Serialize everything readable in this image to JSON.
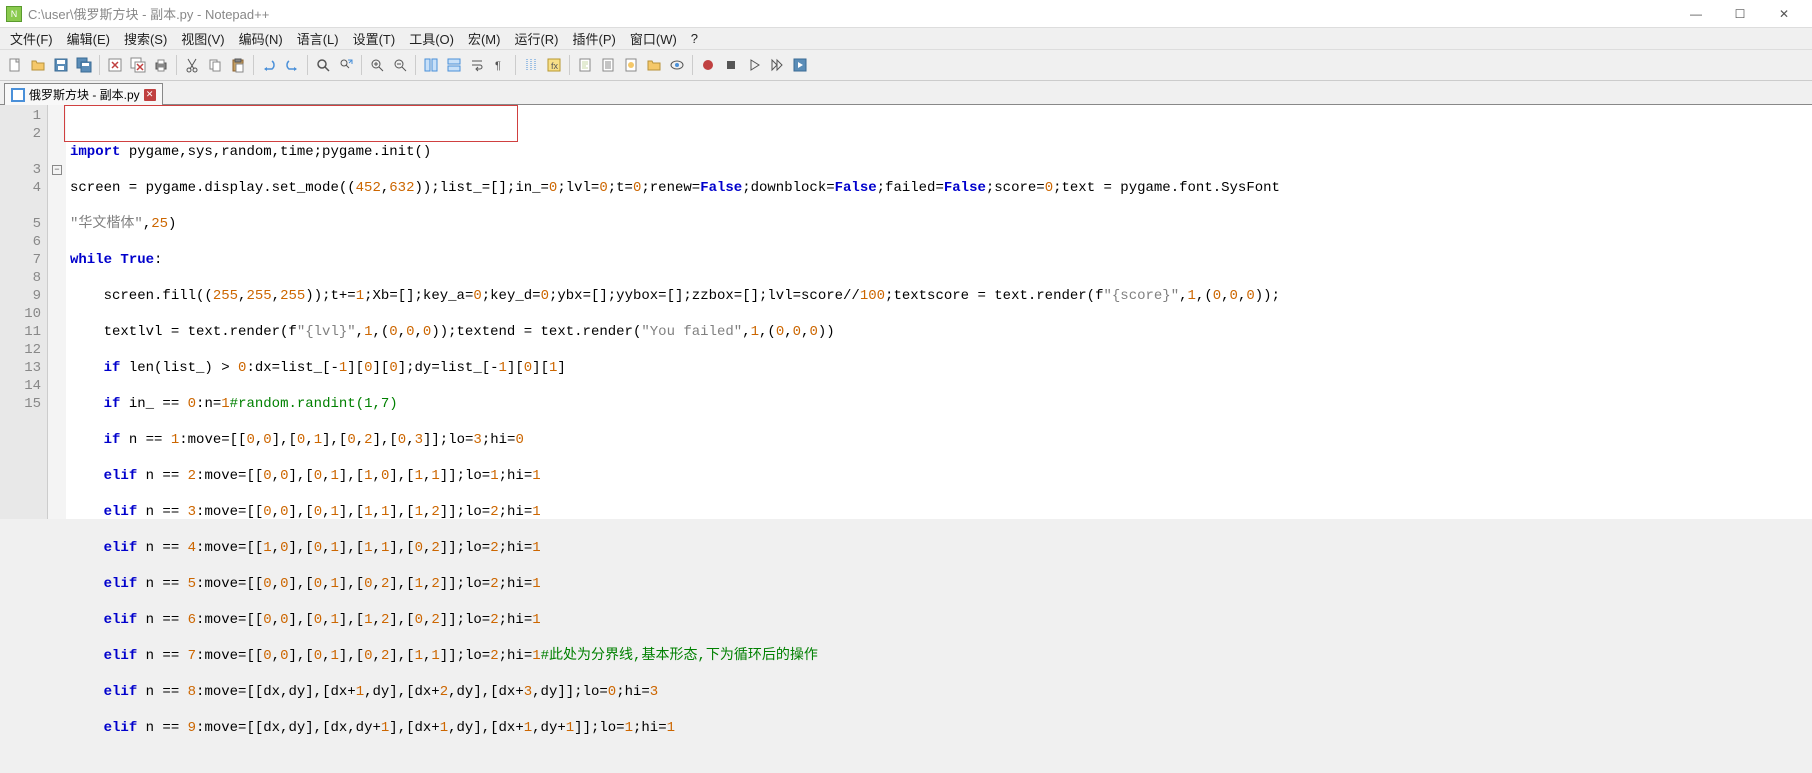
{
  "window": {
    "title": "C:\\user\\俄罗斯方块 - 副本.py - Notepad++"
  },
  "menu": {
    "items": [
      "文件(F)",
      "编辑(E)",
      "搜索(S)",
      "视图(V)",
      "编码(N)",
      "语言(L)",
      "设置(T)",
      "工具(O)",
      "宏(M)",
      "运行(R)",
      "插件(P)",
      "窗口(W)",
      "?"
    ]
  },
  "tab": {
    "label": "俄罗斯方块 - 副本.py"
  },
  "gutter": {
    "lines": [
      "1",
      "2",
      "",
      "3",
      "4",
      "",
      "5",
      "6",
      "7",
      "8",
      "9",
      "10",
      "11",
      "12",
      "13",
      "14",
      "15"
    ]
  },
  "code": {
    "l1": {
      "a": "import",
      "b": " pygame,sys,random,time;pygame.init()"
    },
    "l2": {
      "a": "screen = pygame.display.set_mode((",
      "n1": "452",
      "c1": ",",
      "n2": "632",
      "b": "));list_=[];in_=",
      "n3": "0",
      "c2": ";lvl=",
      "n4": "0",
      "c3": ";t=",
      "n5": "0",
      "c4": ";renew=",
      "bf1": "False",
      "c5": ";downblock=",
      "bf2": "False",
      "c6": ";failed=",
      "bf3": "False",
      "c7": ";score=",
      "n6": "0",
      "c8": ";text = pygame.font.SysFont"
    },
    "l2b": {
      "s": "\"华文楷体\"",
      "c": ",",
      "n": "25",
      "p": ")"
    },
    "l3": {
      "a": "while",
      "b": " ",
      "c": "True",
      "d": ":"
    },
    "l4": {
      "a": "    screen.fill((",
      "n1": "255",
      "c1": ",",
      "n2": "255",
      "c2": ",",
      "n3": "255",
      "b": "));t+=",
      "n4": "1",
      "c3": ";Xb=[];key_a=",
      "n5": "0",
      "c4": ";key_d=",
      "n6": "0",
      "c5": ";ybx=[];yybox=[];zzbox=[];lvl=score//",
      "n7": "100",
      "c6": ";textscore = text.render(f",
      "s1": "\"{score}\"",
      "c7": ",",
      "n8": "1",
      "c8": ",(",
      "n9": "0",
      "c9": ",",
      "n10": "0",
      "c10": ",",
      "n11": "0",
      "c11": "));"
    },
    "l4b": {
      "a": "    textlvl = text.render(f",
      "s1": "\"{lvl}\"",
      "c1": ",",
      "n1": "1",
      "c2": ",(",
      "n2": "0",
      "c3": ",",
      "n3": "0",
      "c4": ",",
      "n4": "0",
      "b": "));textend = text.render(",
      "s2": "\"You failed\"",
      "c5": ",",
      "n5": "1",
      "c6": ",(",
      "n6": "0",
      "c7": ",",
      "n7": "0",
      "c8": ",",
      "n8": "0",
      "c9": "))"
    },
    "l5": {
      "a": "    ",
      "kw": "if",
      "b": " len(list_) > ",
      "n1": "0",
      "c": ":dx=list_[-",
      "n2": "1",
      "d": "][",
      "n3": "0",
      "e": "][",
      "n4": "0",
      "f": "];dy=list_[-",
      "n5": "1",
      "g": "][",
      "n6": "0",
      "h": "][",
      "n7": "1",
      "i": "]"
    },
    "l6": {
      "a": "    ",
      "kw": "if",
      "b": " in_ == ",
      "n1": "0",
      "c": ":n=",
      "n2": "1",
      "com": "#random.randint(1,7)"
    },
    "l7": {
      "a": "    ",
      "kw": "if",
      "b": " n == ",
      "n1": "1",
      "c": ":move=[[",
      "n2": "0",
      "c1": ",",
      "n3": "0",
      "c2": "],[",
      "n4": "0",
      "c3": ",",
      "n5": "1",
      "c4": "],[",
      "n6": "0",
      "c5": ",",
      "n7": "2",
      "c6": "],[",
      "n8": "0",
      "c7": ",",
      "n9": "3",
      "c8": "]];lo=",
      "n10": "3",
      "c9": ";hi=",
      "n11": "0"
    },
    "l8": {
      "a": "    ",
      "kw": "elif",
      "b": " n == ",
      "n1": "2",
      "c": ":move=[[",
      "n2": "0",
      "c1": ",",
      "n3": "0",
      "c2": "],[",
      "n4": "0",
      "c3": ",",
      "n5": "1",
      "c4": "],[",
      "n6": "1",
      "c5": ",",
      "n7": "0",
      "c6": "],[",
      "n8": "1",
      "c7": ",",
      "n9": "1",
      "c8": "]];lo=",
      "n10": "1",
      "c9": ";hi=",
      "n11": "1"
    },
    "l9": {
      "a": "    ",
      "kw": "elif",
      "b": " n == ",
      "n1": "3",
      "c": ":move=[[",
      "n2": "0",
      "c1": ",",
      "n3": "0",
      "c2": "],[",
      "n4": "0",
      "c3": ",",
      "n5": "1",
      "c4": "],[",
      "n6": "1",
      "c5": ",",
      "n7": "1",
      "c6": "],[",
      "n8": "1",
      "c7": ",",
      "n9": "2",
      "c8": "]];lo=",
      "n10": "2",
      "c9": ";hi=",
      "n11": "1"
    },
    "l10": {
      "a": "    ",
      "kw": "elif",
      "b": " n == ",
      "n1": "4",
      "c": ":move=[[",
      "n2": "1",
      "c1": ",",
      "n3": "0",
      "c2": "],[",
      "n4": "0",
      "c3": ",",
      "n5": "1",
      "c4": "],[",
      "n6": "1",
      "c5": ",",
      "n7": "1",
      "c6": "],[",
      "n8": "0",
      "c7": ",",
      "n9": "2",
      "c8": "]];lo=",
      "n10": "2",
      "c9": ";hi=",
      "n11": "1"
    },
    "l11": {
      "a": "    ",
      "kw": "elif",
      "b": " n == ",
      "n1": "5",
      "c": ":move=[[",
      "n2": "0",
      "c1": ",",
      "n3": "0",
      "c2": "],[",
      "n4": "0",
      "c3": ",",
      "n5": "1",
      "c4": "],[",
      "n6": "0",
      "c5": ",",
      "n7": "2",
      "c6": "],[",
      "n8": "1",
      "c7": ",",
      "n9": "2",
      "c8": "]];lo=",
      "n10": "2",
      "c9": ";hi=",
      "n11": "1"
    },
    "l12": {
      "a": "    ",
      "kw": "elif",
      "b": " n == ",
      "n1": "6",
      "c": ":move=[[",
      "n2": "0",
      "c1": ",",
      "n3": "0",
      "c2": "],[",
      "n4": "0",
      "c3": ",",
      "n5": "1",
      "c4": "],[",
      "n6": "1",
      "c5": ",",
      "n7": "2",
      "c6": "],[",
      "n8": "0",
      "c7": ",",
      "n9": "2",
      "c8": "]];lo=",
      "n10": "2",
      "c9": ";hi=",
      "n11": "1"
    },
    "l13": {
      "a": "    ",
      "kw": "elif",
      "b": " n == ",
      "n1": "7",
      "c": ":move=[[",
      "n2": "0",
      "c1": ",",
      "n3": "0",
      "c2": "],[",
      "n4": "0",
      "c3": ",",
      "n5": "1",
      "c4": "],[",
      "n6": "0",
      "c5": ",",
      "n7": "2",
      "c6": "],[",
      "n8": "1",
      "c7": ",",
      "n9": "1",
      "c8": "]];lo=",
      "n10": "2",
      "c9": ";hi=",
      "n11": "1",
      "com": "#此处为分界线,基本形态,下为循环后的操作"
    },
    "l14": {
      "a": "    ",
      "kw": "elif",
      "b": " n == ",
      "n1": "8",
      "c": ":move=[[dx,dy],[dx+",
      "n2": "1",
      "c1": ",dy],[dx+",
      "n3": "2",
      "c2": ",dy],[dx+",
      "n4": "3",
      "c3": ",dy]];lo=",
      "n5": "0",
      "c4": ";hi=",
      "n6": "3"
    },
    "l15": {
      "a": "    ",
      "kw": "elif",
      "b": " n == ",
      "n1": "9",
      "c": ":move=[[dx,dy],[dx,dy+",
      "n2": "1",
      "c1": "],[dx+",
      "n3": "1",
      "c2": ",dy],[dx+",
      "n4": "1",
      "c3": ",dy+",
      "n5": "1",
      "c4": "]];lo=",
      "n6": "1",
      "c5": ";hi=",
      "n7": "1"
    }
  }
}
